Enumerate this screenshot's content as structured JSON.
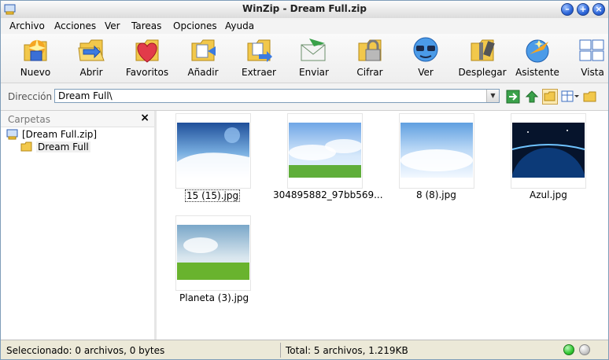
{
  "window": {
    "title": "WinZip - Dream Full.zip"
  },
  "menu": [
    "Archivo",
    "Acciones",
    "Ver",
    "Tareas",
    "Opciones",
    "Ayuda"
  ],
  "toolbar": [
    {
      "label": "Nuevo",
      "icon": "new-archive-icon"
    },
    {
      "label": "Abrir",
      "icon": "open-icon"
    },
    {
      "label": "Favoritos",
      "icon": "favorites-heart-icon"
    },
    {
      "label": "Añadir",
      "icon": "add-files-icon"
    },
    {
      "label": "Extraer",
      "icon": "extract-icon"
    },
    {
      "label": "Enviar",
      "icon": "send-mail-icon"
    },
    {
      "label": "Cifrar",
      "icon": "encrypt-lock-icon"
    },
    {
      "label": "Ver",
      "icon": "view-glasses-icon"
    },
    {
      "label": "Desplegar",
      "icon": "unzip-icon"
    },
    {
      "label": "Asistente",
      "icon": "wizard-icon"
    },
    {
      "label": "Vista",
      "icon": "view-mode-icon"
    }
  ],
  "address": {
    "label": "Dirección",
    "value": "Dream Full\\"
  },
  "folders_panel": {
    "title": "Carpetas",
    "close": "×",
    "tree": [
      {
        "label": "[Dream Full.zip]"
      },
      {
        "label": "Dream Full"
      }
    ]
  },
  "files": [
    {
      "name": "15 (15).jpg",
      "selected": true
    },
    {
      "name": "304895882_97bb569...",
      "selected": false
    },
    {
      "name": "8 (8).jpg",
      "selected": false
    },
    {
      "name": "Azul.jpg",
      "selected": false
    },
    {
      "name": "Planeta (3).jpg",
      "selected": false
    }
  ],
  "status": {
    "selected": "Seleccionado: 0 archivos, 0 bytes",
    "total": "Total: 5 archivos, 1.219KB"
  },
  "colors": {
    "accent": "#2d66d9",
    "led_on": "#32c832",
    "led_off": "#c8c8c8"
  }
}
